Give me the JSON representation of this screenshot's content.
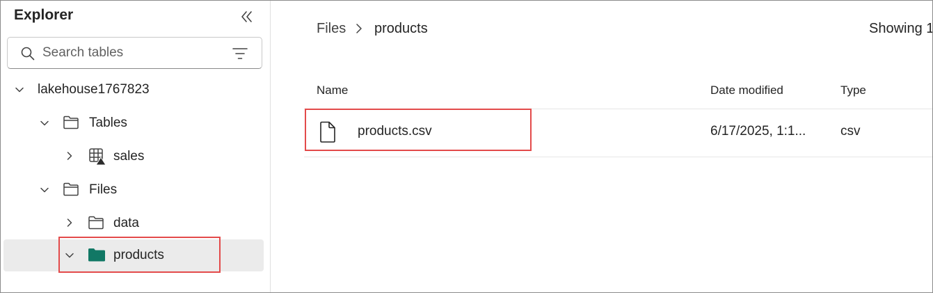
{
  "explorer": {
    "title": "Explorer",
    "search": {
      "placeholder": "Search tables",
      "value": ""
    },
    "tree": {
      "lakehouse": "lakehouse1767823",
      "tables_folder": "Tables",
      "sales_table": "sales",
      "files_folder": "Files",
      "data_folder": "data",
      "products_folder": "products"
    }
  },
  "main": {
    "breadcrumb": {
      "root": "Files",
      "current": "products"
    },
    "showing_text": "Showing 1",
    "columns": {
      "name": "Name",
      "date_modified": "Date modified",
      "type": "Type"
    },
    "files": [
      {
        "name": "products.csv",
        "date_modified": "6/17/2025, 1:1...",
        "type": "csv"
      }
    ]
  },
  "colors": {
    "accent_folder": "#117865",
    "highlight_border": "#e34a4a",
    "selected_row": "#ebebeb"
  },
  "icons": {
    "collapse": "double-chevron-left-icon",
    "search": "search-icon",
    "filter": "filter-icon",
    "folder": "folder-icon",
    "table": "table-icon",
    "file": "file-icon"
  }
}
